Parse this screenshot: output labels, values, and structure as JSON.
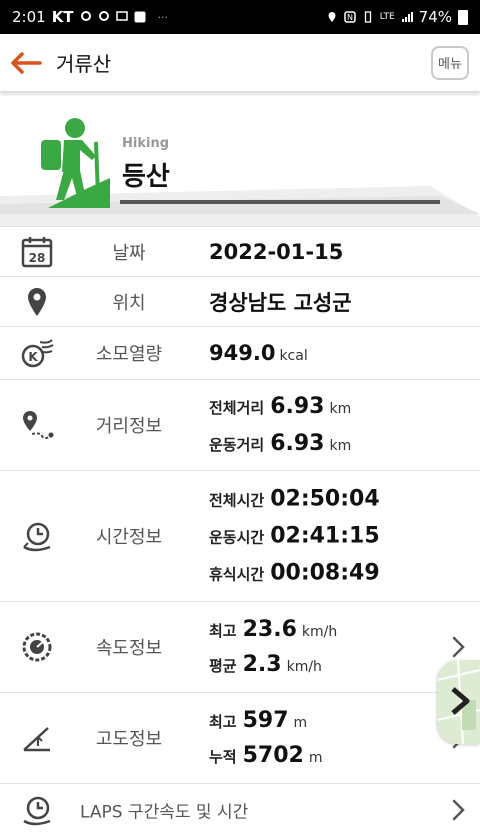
{
  "status_bar": {
    "time": "2:01",
    "carrier": "KT",
    "lte": "LTE",
    "battery": "74%"
  },
  "header": {
    "title": "거류산",
    "menu_label": "메뉴"
  },
  "hero": {
    "activity_en": "Hiking",
    "activity_kr": "등산"
  },
  "rows": {
    "date": {
      "label": "날짜",
      "value": "2022-01-15",
      "icon_day": "28"
    },
    "location": {
      "label": "위치",
      "value": "경상남도 고성군"
    },
    "calories": {
      "label": "소모열량",
      "value": "949.0",
      "unit": "kcal"
    },
    "distance": {
      "label": "거리정보",
      "lines": [
        {
          "key": "전체거리",
          "value": "6.93",
          "unit": "km"
        },
        {
          "key": "운동거리",
          "value": "6.93",
          "unit": "km"
        }
      ]
    },
    "time": {
      "label": "시간정보",
      "lines": [
        {
          "key": "전체시간",
          "value": "02:50:04"
        },
        {
          "key": "운동시간",
          "value": "02:41:15"
        },
        {
          "key": "휴식시간",
          "value": "00:08:49"
        }
      ]
    },
    "speed": {
      "label": "속도정보",
      "lines": [
        {
          "key": "최고",
          "value": "23.6",
          "unit": "km/h"
        },
        {
          "key": "평균",
          "value": "2.3",
          "unit": "km/h"
        }
      ]
    },
    "altitude": {
      "label": "고도정보",
      "lines": [
        {
          "key": "최고",
          "value": "597",
          "unit": "m"
        },
        {
          "key": "누적",
          "value": "5702",
          "unit": "m"
        }
      ]
    },
    "laps": {
      "label": "LAPS 구간속도 및 시간"
    }
  },
  "colors": {
    "accent_green": "#3aa843",
    "back_arrow": "#d8541c",
    "icon_gray": "#444444"
  }
}
